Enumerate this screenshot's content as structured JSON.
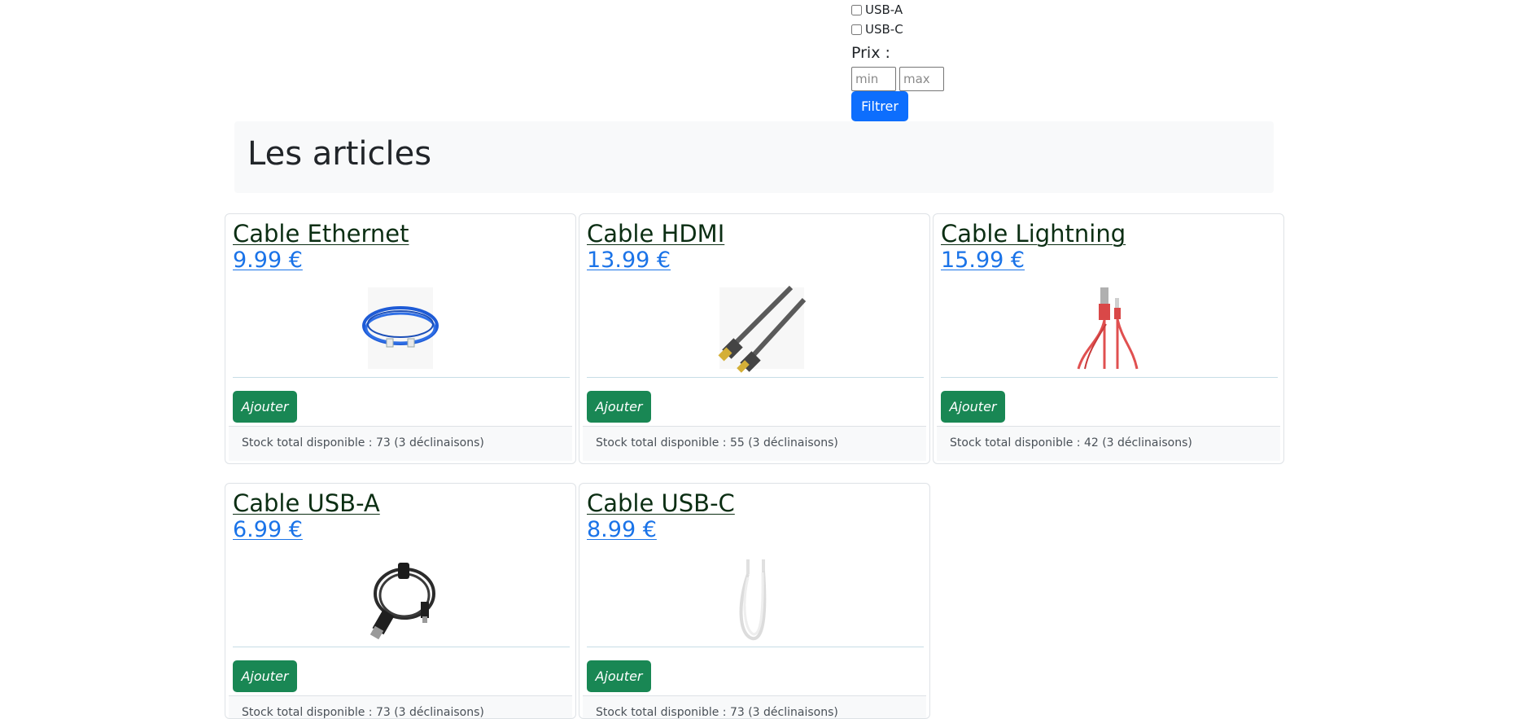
{
  "filters": {
    "options": [
      {
        "label": "USB-A",
        "checked": false
      },
      {
        "label": "USB-C",
        "checked": false
      }
    ],
    "price_label": "Prix :",
    "min_placeholder": "min",
    "max_placeholder": "max",
    "button_label": "Filtrer"
  },
  "header": {
    "title": "Les articles"
  },
  "products": [
    {
      "name": "Cable Ethernet",
      "price": "9.99 €",
      "add_label": "Ajouter",
      "stock": "Stock total disponible : 73 (3 déclinaisons)"
    },
    {
      "name": "Cable HDMI",
      "price": "13.99 €",
      "add_label": "Ajouter",
      "stock": "Stock total disponible : 55 (3 déclinaisons)"
    },
    {
      "name": "Cable Lightning",
      "price": "15.99 €",
      "add_label": "Ajouter",
      "stock": "Stock total disponible : 42 (3 déclinaisons)"
    },
    {
      "name": "Cable USB-A",
      "price": "6.99 €",
      "add_label": "Ajouter",
      "stock": "Stock total disponible : 73 (3 déclinaisons)"
    },
    {
      "name": "Cable USB-C",
      "price": "8.99 €",
      "add_label": "Ajouter",
      "stock": "Stock total disponible : 73 (3 déclinaisons)"
    }
  ],
  "colors": {
    "primary": "#0d6efd",
    "success": "#198754",
    "link": "#1a73e8",
    "title_link": "#0b2e13"
  }
}
